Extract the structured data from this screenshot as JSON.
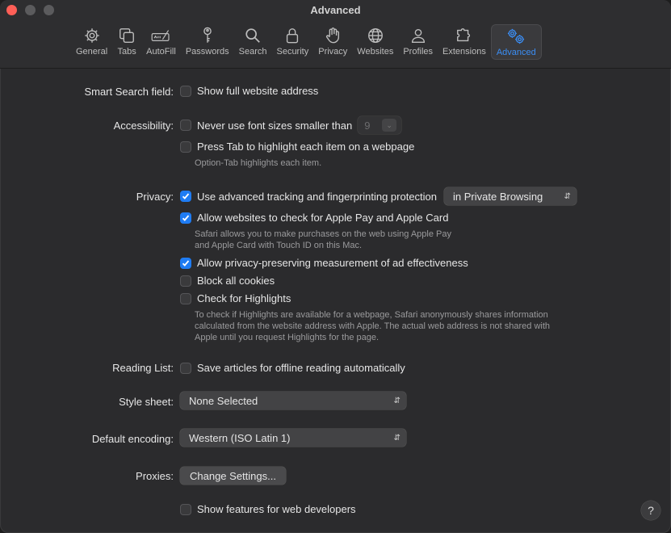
{
  "window": {
    "title": "Advanced"
  },
  "toolbar": {
    "items": [
      {
        "label": "General",
        "icon": "gear-icon"
      },
      {
        "label": "Tabs",
        "icon": "tabs-icon"
      },
      {
        "label": "AutoFill",
        "icon": "autofill-icon"
      },
      {
        "label": "Passwords",
        "icon": "key-icon"
      },
      {
        "label": "Search",
        "icon": "search-icon"
      },
      {
        "label": "Security",
        "icon": "lock-icon"
      },
      {
        "label": "Privacy",
        "icon": "hand-icon"
      },
      {
        "label": "Websites",
        "icon": "globe-icon"
      },
      {
        "label": "Profiles",
        "icon": "person-icon"
      },
      {
        "label": "Extensions",
        "icon": "puzzle-icon"
      },
      {
        "label": "Advanced",
        "icon": "gears-icon",
        "active": true
      }
    ],
    "accent": "#3b8ef5"
  },
  "smart_search": {
    "label": "Smart Search field:",
    "show_full_address": {
      "label": "Show full website address",
      "checked": false
    }
  },
  "accessibility": {
    "label": "Accessibility:",
    "min_font": {
      "label": "Never use font sizes smaller than",
      "checked": false,
      "value": "9"
    },
    "press_tab": {
      "label": "Press Tab to highlight each item on a webpage",
      "checked": false
    },
    "note": "Option-Tab highlights each item."
  },
  "privacy": {
    "label": "Privacy:",
    "advanced_tracking": {
      "label": "Use advanced tracking and fingerprinting protection",
      "checked": true,
      "option": "in Private Browsing"
    },
    "apple_pay": {
      "label": "Allow websites to check for Apple Pay and Apple Card",
      "checked": true
    },
    "apple_pay_note_1": "Safari allows you to make purchases on the web using Apple Pay",
    "apple_pay_note_2": "and Apple Card with Touch ID on this Mac.",
    "ad_measurement": {
      "label": "Allow privacy-preserving measurement of ad effectiveness",
      "checked": true
    },
    "block_cookies": {
      "label": "Block all cookies",
      "checked": false
    },
    "highlights": {
      "label": "Check for Highlights",
      "checked": false
    },
    "highlights_note_1": "To check if Highlights are available for a webpage, Safari anonymously shares information",
    "highlights_note_2": "calculated from the website address with Apple. The actual web address is not shared with",
    "highlights_note_3": "Apple until you request Highlights for the page."
  },
  "reading_list": {
    "label": "Reading List:",
    "offline": {
      "label": "Save articles for offline reading automatically",
      "checked": false
    }
  },
  "style_sheet": {
    "label": "Style sheet:",
    "value": "None Selected"
  },
  "encoding": {
    "label": "Default encoding:",
    "value": "Western (ISO Latin 1)"
  },
  "proxies": {
    "label": "Proxies:",
    "button": "Change Settings..."
  },
  "developer": {
    "label": "Show features for web developers",
    "checked": false
  },
  "help": {
    "label": "?"
  }
}
